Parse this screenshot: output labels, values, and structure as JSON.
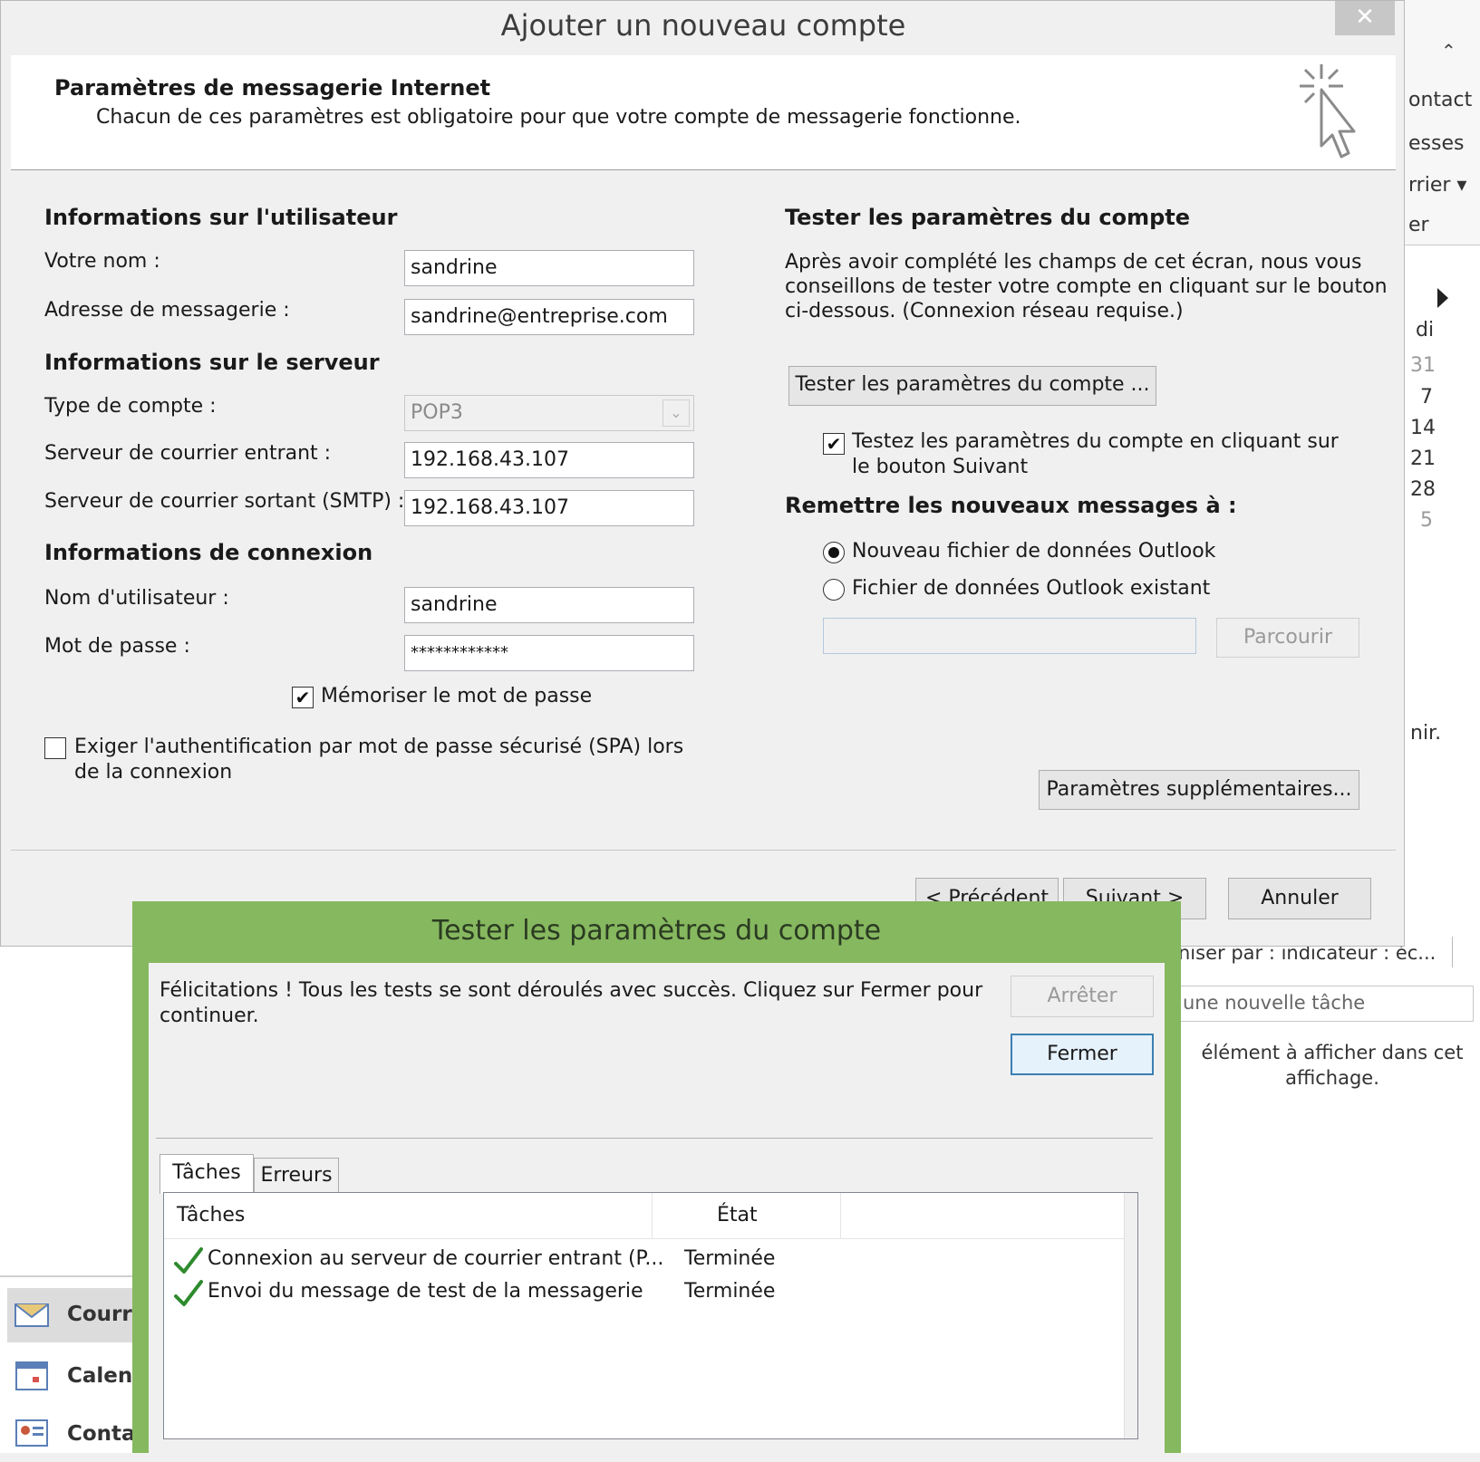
{
  "background": {
    "ribbon_fragments": [
      "ontact",
      "esses",
      "rrier ▾",
      "er"
    ],
    "calendar_weekday": "di",
    "calendar_days": [
      "31",
      "7",
      "14",
      "21",
      "28",
      "5"
    ],
    "fragment_nir": "nir.",
    "tasks_arrange": "niser par : indicateur : éc...",
    "new_task_placeholder": "une nouvelle tâche",
    "empty_message": "élément à afficher dans cet affichage.",
    "nav": [
      "Courri",
      "Calend",
      "Conta"
    ]
  },
  "dialog": {
    "title": "Ajouter un nouveau compte",
    "close": "✕",
    "header_title": "Paramètres de messagerie Internet",
    "header_subtitle": "Chacun de ces paramètres est obligatoire pour que votre compte de messagerie fonctionne.",
    "user_section": "Informations sur l'utilisateur",
    "name_label": "Votre nom :",
    "name_value": "sandrine",
    "email_label": "Adresse de messagerie :",
    "email_value": "sandrine@entreprise.com",
    "server_section": "Informations sur le serveur",
    "account_type_label": "Type de compte :",
    "account_type_value": "POP3",
    "incoming_label": "Serveur de courrier entrant :",
    "incoming_value": "192.168.43.107",
    "outgoing_label": "Serveur de courrier sortant (SMTP) :",
    "outgoing_value": "192.168.43.107",
    "logon_section": "Informations de connexion",
    "username_label": "Nom d'utilisateur :",
    "username_value": "sandrine",
    "password_label": "Mot de passe :",
    "password_value": "************",
    "remember_label": "Mémoriser le mot de passe",
    "remember_checked": true,
    "spa_label_1": "Exiger l'authentification par mot de passe sécurisé (SPA) lors",
    "spa_label_2": "de la connexion",
    "spa_checked": false,
    "test_section": "Tester les paramètres du compte",
    "test_para_1": "Après avoir complété les champs de cet écran, nous vous",
    "test_para_2": "conseillons de tester votre compte en cliquant sur le bouton",
    "test_para_3": "ci-dessous. (Connexion réseau requise.)",
    "test_button": "Tester les paramètres du compte ...",
    "auto_test_1": "Testez les paramètres du compte en cliquant sur",
    "auto_test_2": "le bouton Suivant",
    "auto_test_checked": true,
    "deliver_section": "Remettre les nouveaux messages à :",
    "radio_new": "Nouveau fichier de données Outlook",
    "radio_existing": "Fichier de données Outlook existant",
    "selected_radio": "new",
    "existing_path": "",
    "browse_button": "Parcourir",
    "more_settings_button": "Paramètres supplémentaires...",
    "back_button": "< Précédent",
    "next_button": "Suivant >",
    "cancel_button": "Annuler"
  },
  "test_dialog": {
    "title": "Tester les paramètres du compte",
    "message_1": "Félicitations ! Tous les tests se sont déroulés avec succès. Cliquez sur Fermer pour",
    "message_2": "continuer.",
    "stop_button": "Arrêter",
    "close_button": "Fermer",
    "tabs": [
      "Tâches",
      "Erreurs"
    ],
    "active_tab": "Tâches",
    "columns": [
      "Tâches",
      "État"
    ],
    "rows": [
      {
        "task": "Connexion au serveur de courrier entrant (P...",
        "state": "Terminée",
        "icon": "check-icon"
      },
      {
        "task": "Envoi du message de test de la messagerie",
        "state": "Terminée",
        "icon": "check-icon"
      }
    ],
    "colors": {
      "frame": "#86b85f",
      "check": "#2e8b2e"
    }
  }
}
